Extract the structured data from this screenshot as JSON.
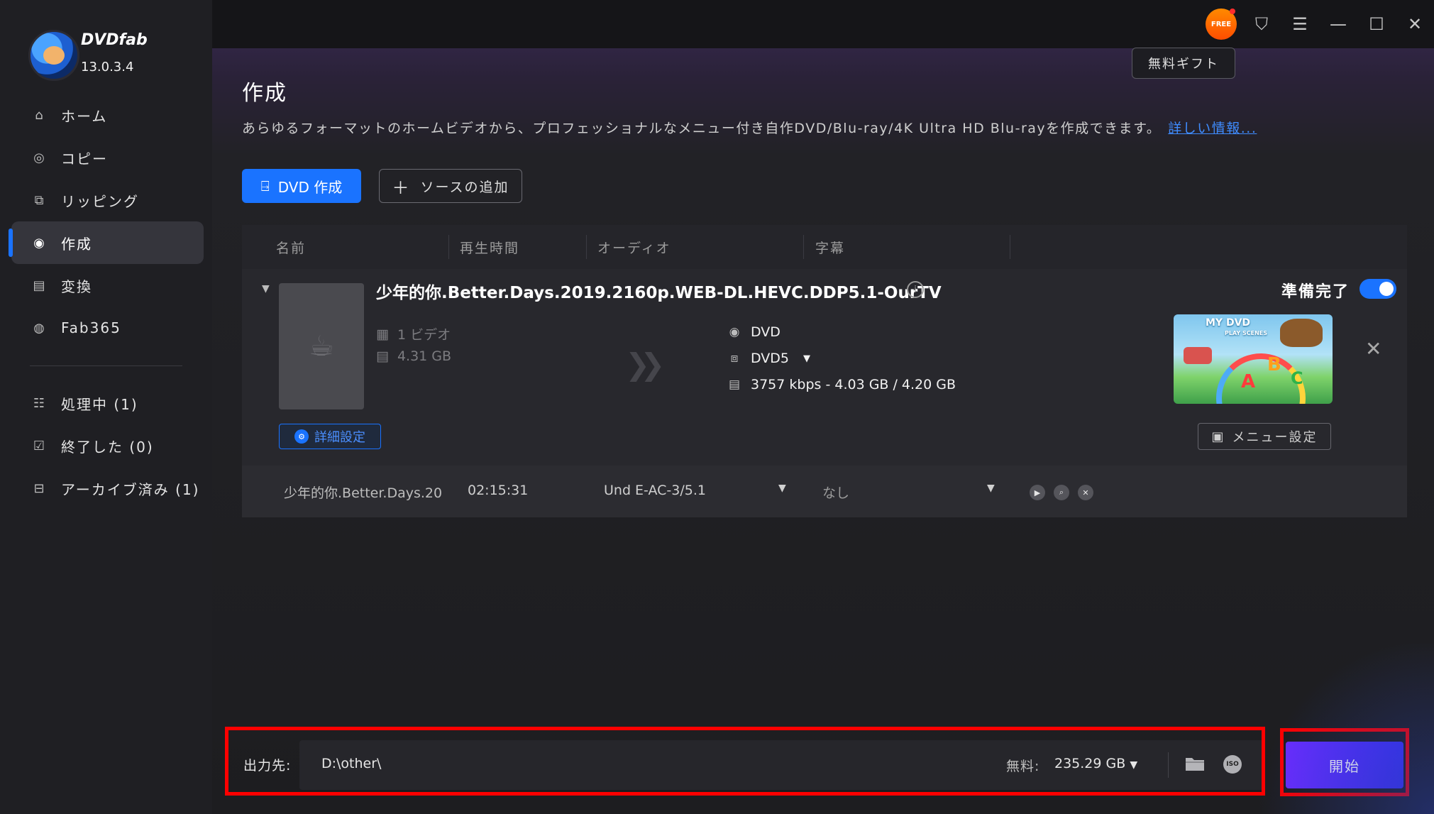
{
  "app": {
    "brand": "DVDfab",
    "version": "13.0.3.4",
    "free_badge": "FREE",
    "gift_button": "無料ギフト"
  },
  "sidebar": {
    "items": [
      {
        "label": "ホーム",
        "icon": "home-icon"
      },
      {
        "label": "コピー",
        "icon": "copy-icon"
      },
      {
        "label": "リッピング",
        "icon": "ripper-icon"
      },
      {
        "label": "作成",
        "icon": "creator-icon",
        "active": true
      },
      {
        "label": "変換",
        "icon": "converter-icon"
      },
      {
        "label": "Fab365",
        "icon": "fab365-icon"
      }
    ],
    "queue": [
      {
        "label": "処理中 (1)",
        "icon": "processing-icon"
      },
      {
        "label": "終了した (0)",
        "icon": "finished-icon"
      },
      {
        "label": "アーカイブ済み (1)",
        "icon": "archive-icon"
      }
    ]
  },
  "main": {
    "title": "作成",
    "description": "あらゆるフォーマットのホームビデオから、プロフェッショナルなメニュー付き自作DVD/Blu-ray/4K Ultra HD Blu-rayを作成できます。",
    "more_info": "詳しい情報...",
    "mode_button": "DVD 作成",
    "add_source_button": "ソースの追加",
    "table": {
      "headers": [
        "名前",
        "再生時間",
        "オーディオ",
        "字幕"
      ],
      "item": {
        "title": "少年的你.Better.Days.2019.2160p.WEB-DL.HEVC.DDP5.1-OurTV",
        "status": "準備完了",
        "video_count": "1 ビデオ",
        "source_size": "4.31 GB",
        "output_format": "DVD",
        "disc_type": "DVD5",
        "bitrate": "3757 kbps - 4.03 GB / 4.20 GB",
        "detail_button": "詳細設定",
        "menu_button": "メニュー設定",
        "menu_thumb": {
          "line1": "MY DVD",
          "line2": "PLAY SCENES"
        }
      },
      "track": {
        "name": "少年的你.Better.Days.20",
        "duration": "02:15:31",
        "audio": "Und  E-AC-3/5.1",
        "subtitle": "なし"
      }
    }
  },
  "footer": {
    "output_label": "出力先:",
    "output_path": "D:\\other\\",
    "free_label": "無料:",
    "free_space": "235.29 GB",
    "start_button": "開始"
  },
  "colors": {
    "accent": "#1a73ff",
    "start": "#5a2fff",
    "highlight": "#ff0000"
  }
}
